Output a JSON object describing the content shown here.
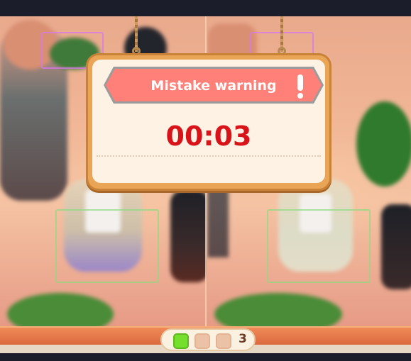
{
  "dialog": {
    "title": "Mistake warning",
    "timer": "00:03",
    "icon": "exclamation-icon"
  },
  "progress": {
    "count": "3",
    "found_states": [
      true,
      false,
      false
    ]
  },
  "colors": {
    "banner": "#ff8079",
    "timer": "#d8141a",
    "found_dot": "#74e02b",
    "pending_dot": "#ecc2a6"
  }
}
